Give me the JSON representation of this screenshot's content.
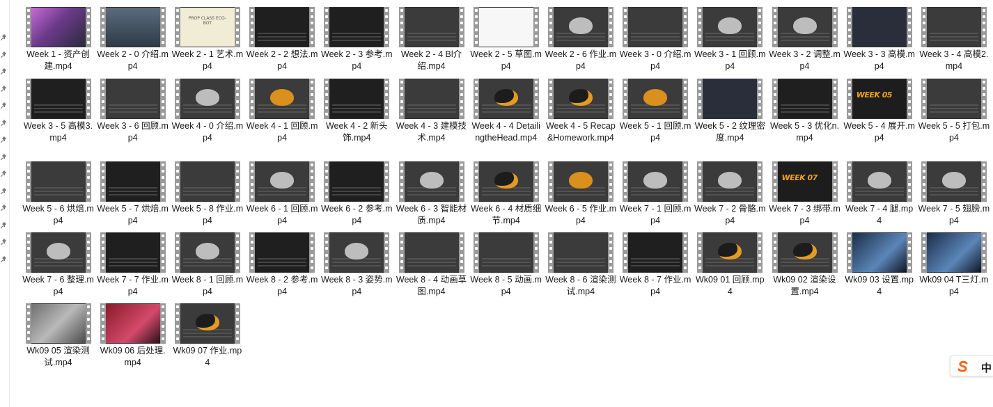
{
  "files": [
    {
      "label": "Week 1 - 资产创建.mp4",
      "thumb": "pink"
    },
    {
      "label": "Week 2 - 0 介绍.mp4",
      "thumb": "person"
    },
    {
      "label": "Week 2 - 1 艺术.mp4",
      "thumb": "paper",
      "thumb_text": "PROP CLASS ECO-BOT"
    },
    {
      "label": "Week 2 - 2 想法.mp4",
      "thumb": "dark"
    },
    {
      "label": "Week 2 - 3 参考.mp4",
      "thumb": "dark"
    },
    {
      "label": "Week 2 - 4 Bl介绍.mp4",
      "thumb": "ui"
    },
    {
      "label": "Week 2 - 5 草图.mp4",
      "thumb": "white"
    },
    {
      "label": "Week 2 - 6 作业.mp4",
      "thumb": "bug-grey"
    },
    {
      "label": "Week 3 - 0 介绍.mp4",
      "thumb": "ui"
    },
    {
      "label": "Week 3 - 1 回顾.mp4",
      "thumb": "bug-grey"
    },
    {
      "label": "Week 3 - 2 调整.mp4",
      "thumb": "bug-grey"
    },
    {
      "label": "Week 3 - 3 高模.mp4",
      "thumb": "web"
    },
    {
      "label": "Week 3 - 4 高模2.mp4",
      "thumb": "ui"
    },
    {
      "label": "Week 3 - 5 高模3.mp4",
      "thumb": "dark"
    },
    {
      "label": "Week 3 - 6 回顾.mp4",
      "thumb": "ui"
    },
    {
      "label": "Week 4 - 0 介绍.mp4",
      "thumb": "bug-grey"
    },
    {
      "label": "Week 4 - 1 回顾.mp4",
      "thumb": "bug-orange"
    },
    {
      "label": "Week 4 - 2 新头饰.mp4",
      "thumb": "dark"
    },
    {
      "label": "Week 4 - 3 建模技术.mp4",
      "thumb": "ui"
    },
    {
      "label": "Week 4 - 4 DetailingtheHead.mp4",
      "thumb": "bug-dark"
    },
    {
      "label": "Week 4 - 5 Recap&Homework.mp4",
      "thumb": "bug-dark"
    },
    {
      "label": "Week 5 - 1 回顾.mp4",
      "thumb": "bug-orange"
    },
    {
      "label": "Week 5 - 2 纹理密度.mp4",
      "thumb": "web"
    },
    {
      "label": "Week 5 - 3 优化n.mp4",
      "thumb": "dark"
    },
    {
      "label": "Week 5 - 4 展开.mp4",
      "thumb": "orange",
      "thumb_text": "WEEK 05"
    },
    {
      "label": "Week 5 - 5 打包.mp4",
      "thumb": "ui"
    },
    {
      "label": "Week 5 - 6 烘焙.mp4",
      "thumb": "ui"
    },
    {
      "label": "Week 5 - 7 烘焙.mp4",
      "thumb": "dark"
    },
    {
      "label": "Week 5 - 8 作业.mp4",
      "thumb": "ui"
    },
    {
      "label": "Week 6 - 1 回顾.mp4",
      "thumb": "bug-grey"
    },
    {
      "label": "Week 6 - 2 参考.mp4",
      "thumb": "dark"
    },
    {
      "label": "Week 6 - 3 智能材质.mp4",
      "thumb": "bug-grey"
    },
    {
      "label": "Week 6 - 4 材质细节.mp4",
      "thumb": "bug-dark"
    },
    {
      "label": "Week 6 - 5 作业.mp4",
      "thumb": "bug-orange"
    },
    {
      "label": "Week 7 - 1 回顾.mp4",
      "thumb": "bug-grey"
    },
    {
      "label": "Week 7 - 2 骨骼.mp4",
      "thumb": "bug-grey"
    },
    {
      "label": "Week 7 - 3 绑带.mp4",
      "thumb": "orange",
      "thumb_text": "WEEK 07"
    },
    {
      "label": "Week 7 - 4 腿.mp4",
      "thumb": "bug-grey"
    },
    {
      "label": "Week 7 - 5 翅膀.mp4",
      "thumb": "bug-grey"
    },
    {
      "label": "Week 7 - 6 整理.mp4",
      "thumb": "bug-grey"
    },
    {
      "label": "Week 7 - 7 作业.mp4",
      "thumb": "dark"
    },
    {
      "label": "Week 8 - 1 回顾.mp4",
      "thumb": "bug-grey"
    },
    {
      "label": "Week 8 - 2 参考.mp4",
      "thumb": "dark"
    },
    {
      "label": "Week 8 - 3 姿势.mp4",
      "thumb": "bug-grey"
    },
    {
      "label": "Week 8 - 4 动画草图.mp4",
      "thumb": "ui"
    },
    {
      "label": "Week 8 - 5 动画.mp4",
      "thumb": "ui"
    },
    {
      "label": "Week 8 - 6 渲染测试.mp4",
      "thumb": "ui"
    },
    {
      "label": "Week 8 - 7 作业.mp4",
      "thumb": "dark"
    },
    {
      "label": "Wk09 01 回顾.mp4",
      "thumb": "bug-dark"
    },
    {
      "label": "Wk09 02 渲染设置.mp4",
      "thumb": "bug-dark"
    },
    {
      "label": "Wk09 03 设置.mp4",
      "thumb": "blue"
    },
    {
      "label": "Wk09 04 T三灯.mp4",
      "thumb": "blue"
    },
    {
      "label": "Wk09 05 渲染测试.mp4",
      "thumb": "stone"
    },
    {
      "label": "Wk09 06 后处理.mp4",
      "thumb": "red"
    },
    {
      "label": "Wk09 07 作业.mp4",
      "thumb": "bug-dark"
    }
  ],
  "ime": {
    "language": "中",
    "logo": "sogou-s-icon",
    "brand_color": "#f26b1d"
  },
  "sidebar": {
    "pin_icon": "pin-icon",
    "pin_count": 14
  }
}
